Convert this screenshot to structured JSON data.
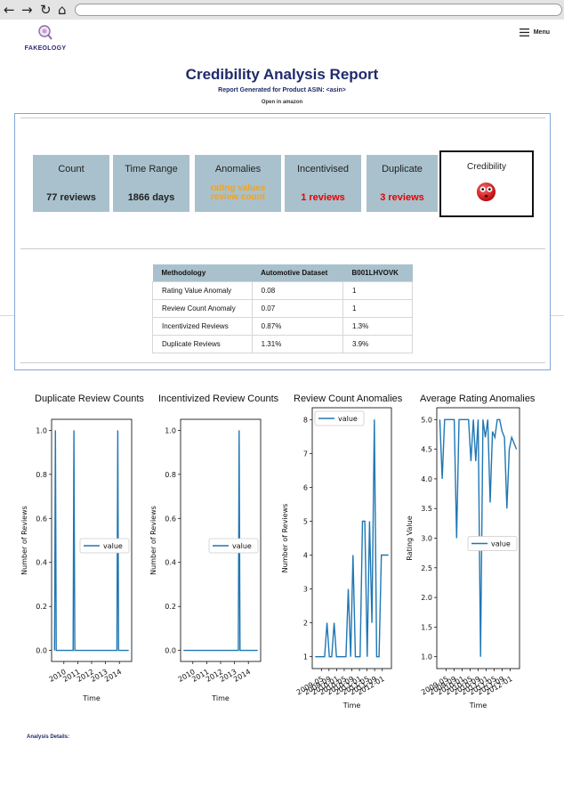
{
  "browser": {
    "back_icon": "←",
    "forward_icon": "→",
    "reload_icon": "↻",
    "home_icon": "⌂"
  },
  "header": {
    "logo_text": "FAKEOLOGY",
    "menu_label": "Menu"
  },
  "report": {
    "title": "Credibility Analysis Report",
    "subtitle": "Report Generated for Product ASIN: <asin>",
    "open_link": "Open in amazon"
  },
  "cards": {
    "count": {
      "label": "Count",
      "value": "77 reviews"
    },
    "time_range": {
      "label": "Time Range",
      "value": "1866 days"
    },
    "anomalies": {
      "label": "Anomalies",
      "line1": "rating values",
      "line2": "review count",
      "color": "#f6a21a"
    },
    "incentivised": {
      "label": "Incentivised",
      "value": "1 reviews",
      "color": "#e60000"
    },
    "duplicate": {
      "label": "Duplicate",
      "value": "3 reviews",
      "color": "#e60000"
    },
    "credibility": {
      "label": "Credibility",
      "icon": "red-face-icon"
    }
  },
  "methodology": {
    "headers": [
      "Methodology",
      "Automotive Dataset",
      "B001LHVOVK"
    ],
    "rows": [
      [
        "Rating Value Anomaly",
        "0.08",
        "1"
      ],
      [
        "Review Count Anomaly",
        "0.07",
        "1"
      ],
      [
        "Incentivized Reviews",
        "0.87%",
        "1.3%"
      ],
      [
        "Duplicate Reviews",
        "1.31%",
        "3.9%"
      ]
    ]
  },
  "chart_data": [
    {
      "type": "line",
      "title": "Duplicate Review Counts",
      "ylabel": "Number of Reviews",
      "xlabel": "Time",
      "ylim": [
        0,
        1
      ],
      "yticks": [
        "0.0",
        "0.2",
        "0.4",
        "0.6",
        "0.8",
        "1.0"
      ],
      "xticks": [
        "2010",
        "2011",
        "2012",
        "2013",
        "2014"
      ],
      "legend": "value",
      "legend_position": "center-right",
      "series": [
        {
          "name": "value",
          "x": [
            2009.6,
            2009.65,
            2009.7,
            2010.7,
            2010.75,
            2010.8,
            2013.3,
            2013.35,
            2013.4,
            2014.0
          ],
          "y": [
            0,
            1,
            0,
            0,
            1,
            0,
            0,
            1,
            0,
            0
          ]
        }
      ]
    },
    {
      "type": "line",
      "title": "Incentivized Review Counts",
      "ylabel": "Number of Reviews",
      "xlabel": "Time",
      "ylim": [
        0,
        1
      ],
      "yticks": [
        "0.0",
        "0.2",
        "0.4",
        "0.6",
        "0.8",
        "1.0"
      ],
      "xticks": [
        "2010",
        "2011",
        "2012",
        "2013",
        "2014"
      ],
      "legend": "value",
      "legend_position": "center-right",
      "series": [
        {
          "name": "value",
          "x": [
            2009.6,
            2012.85,
            2012.9,
            2012.95,
            2014.0
          ],
          "y": [
            0,
            0,
            1,
            0,
            0
          ]
        }
      ]
    },
    {
      "type": "line",
      "title": "Review Count Anomalies",
      "ylabel": "Number of Reviews",
      "xlabel": "Time",
      "ylim": [
        1,
        8
      ],
      "yticks": [
        "1",
        "2",
        "3",
        "4",
        "5",
        "6",
        "7",
        "8"
      ],
      "xticks": [
        "2009-05",
        "2009-09",
        "2010-01",
        "2010-05",
        "2010-09",
        "2011-01",
        "2011-05",
        "2011-09",
        "2012-01"
      ],
      "legend": "value",
      "legend_position": "top-left",
      "series": [
        {
          "name": "value",
          "x": [
            0,
            1,
            2,
            3,
            4,
            5,
            6,
            7,
            8,
            9,
            10,
            11,
            12,
            13,
            14,
            15,
            16,
            17,
            18,
            19,
            20,
            21,
            22,
            23,
            24,
            25,
            26,
            27,
            28,
            29,
            30,
            31
          ],
          "y": [
            1,
            1,
            1,
            1,
            1,
            2,
            1,
            1,
            2,
            1,
            1,
            1,
            1,
            1,
            3,
            1,
            4,
            1,
            1,
            1,
            5,
            5,
            1,
            5,
            2,
            8,
            1,
            1,
            4,
            4,
            4,
            4
          ]
        }
      ]
    },
    {
      "type": "line",
      "title": "Average Rating Anomalies",
      "ylabel": "Rating Value",
      "xlabel": "Time",
      "ylim": [
        1,
        5
      ],
      "yticks": [
        "1.0",
        "1.5",
        "2.0",
        "2.5",
        "3.0",
        "3.5",
        "4.0",
        "4.5",
        "5.0"
      ],
      "xticks": [
        "2009-05",
        "2009-09",
        "2010-01",
        "2010-05",
        "2010-09",
        "2011-01",
        "2011-05",
        "2011-09",
        "2012-01"
      ],
      "legend": "value",
      "legend_position": "center-right",
      "series": [
        {
          "name": "value",
          "x": [
            0,
            1,
            2,
            3,
            4,
            5,
            6,
            7,
            8,
            9,
            10,
            11,
            12,
            13,
            14,
            15,
            16,
            17,
            18,
            19,
            20,
            21,
            22,
            23,
            24,
            25,
            26,
            27,
            28,
            29,
            30,
            31,
            32
          ],
          "y": [
            5,
            4,
            5,
            5,
            5,
            5,
            5,
            3,
            5,
            5,
            5,
            5,
            5,
            4.3,
            5,
            4.3,
            5,
            1,
            5,
            4.7,
            5,
            3.6,
            4.8,
            4.7,
            5,
            5,
            4.8,
            4.7,
            3.5,
            4.5,
            4.7,
            4.6,
            4.5
          ]
        }
      ]
    }
  ],
  "analysis_label": "Analysis Details:"
}
